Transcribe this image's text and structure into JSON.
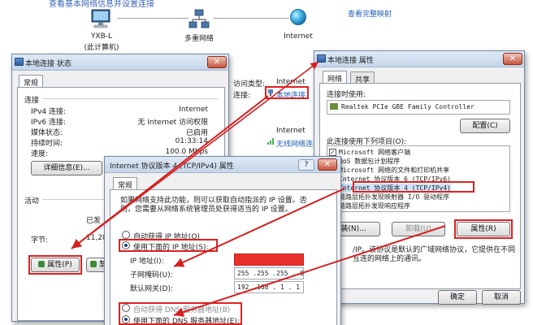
{
  "network_map": {
    "top_text": "查看基本网络信息并设置连接",
    "full_map_link": "查看完整映射",
    "computer_name": "YXB-L",
    "computer_sub": "(此计算机)",
    "network_name": "多重网络",
    "internet_label": "Internet",
    "access_type_label": "访问类型:",
    "access_type_value": "Internet",
    "connection_label": "连接:",
    "connection_value": "本地连接",
    "access_type_value_2": "Internet",
    "wireless_value": "无线网络连接",
    "colors": {
      "link": "#1f5fb8",
      "arrow": "#d42020"
    }
  },
  "status_window": {
    "title": "本地连接 状态",
    "tab": "常规",
    "connection_group": "连接",
    "rows": [
      {
        "label": "IPv4 连接:",
        "value": "Internet"
      },
      {
        "label": "IPv6 连接:",
        "value": "无 Internet 访问权限"
      },
      {
        "label": "媒体状态:",
        "value": "已启用"
      },
      {
        "label": "持续时间:",
        "value": "01:33:14"
      },
      {
        "label": "速度:",
        "value": "100.0 Mbps"
      }
    ],
    "details_button": "详细信息(E)...",
    "activity_group": "活动",
    "sent_label": "已发",
    "bytes_label": "字节:",
    "bytes_value": "11,28",
    "properties_button": "属性(P)",
    "disable_button": "禁用"
  },
  "ipv4_window": {
    "title": "Internet 协议版本 4 (TCP/IPv4) 属性",
    "tab": "常规",
    "description": "如果网络支持此功能，则可以获取自动指派的 IP 设置。否则，您需要从网络系统管理员处获得适当的 IP 设置。",
    "auto_ip": "自动获得 IP 地址(O)",
    "manual_ip": "使用下面的 IP 地址(S):",
    "ip_label": "IP 地址(I):",
    "ip_value": "",
    "mask_label": "子网掩码(U):",
    "mask_value": "255 .255 .255 . 0",
    "gateway_label": "默认网关(D):",
    "gateway_value": "192 .168 . 1 . 1",
    "auto_dns": "自动获得 DNS 服务器地址(B)",
    "manual_dns": "使用下面的 DNS 服务器地址(E):",
    "redaction_color": "#e8312c"
  },
  "props_window": {
    "title": "本地连接 属性",
    "tabs": [
      "网络",
      "共享"
    ],
    "connect_using_label": "连接时使用:",
    "adapter_name": "Realtek PCIe GBE Family Controller",
    "configure_button": "配置(C)",
    "items_label": "此连接使用下列项目(O):",
    "items": [
      {
        "checked": true,
        "text": "Microsoft 网络客户端"
      },
      {
        "checked": true,
        "text": "QoS 数据包计划程序"
      },
      {
        "checked": true,
        "text": "Microsoft 网络的文件和打印机共享"
      },
      {
        "checked": true,
        "text": "Internet 协议版本 6 (TCP/IPv6)"
      },
      {
        "checked": true,
        "text": "Internet 协议版本 4 (TCP/IPv4)"
      },
      {
        "checked": true,
        "text": "链路层拓扑发现映射器 I/O 驱动程序"
      },
      {
        "checked": true,
        "text": "链路层拓扑发现响应程序"
      }
    ],
    "install_button": "装(N)...",
    "uninstall_button": "卸载(U)",
    "properties_button": "属性(R)",
    "description_text": "/IP。该协议是默认的广域网络协议，它提供在不同\n互连的网络上的通讯。",
    "ok_button": "确定",
    "cancel_button": "取消"
  }
}
